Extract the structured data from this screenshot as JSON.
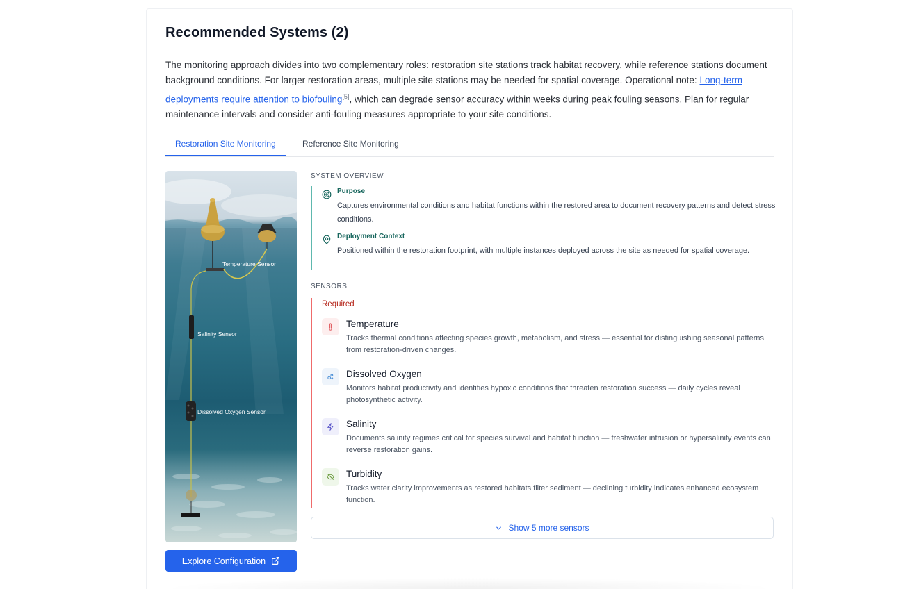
{
  "section": {
    "title": "Recommended Systems (2)",
    "intro_part1": "The monitoring approach divides into two complementary roles: restoration site stations track habitat recovery, while reference stations document background conditions. For larger restoration areas, multiple site stations may be needed for spatial coverage. Operational note: ",
    "intro_link": "Long-term deployments require attention to biofouling",
    "intro_citation": "[5]",
    "intro_part2": ", which can degrade sensor accuracy within weeks during peak fouling seasons. Plan for regular maintenance intervals and consider anti-fouling measures appropriate to your site conditions."
  },
  "tabs": [
    {
      "label": "Restoration Site Monitoring",
      "active": true
    },
    {
      "label": "Reference Site Monitoring",
      "active": false
    }
  ],
  "illustration": {
    "labels": [
      "Temperature Sensor",
      "Salinity Sensor",
      "Dissolved Oxygen Sensor"
    ]
  },
  "explore_button": {
    "label": "Explore Configuration",
    "icon": "external-link-icon"
  },
  "overview": {
    "heading": "SYSTEM OVERVIEW",
    "purpose_title": "Purpose",
    "purpose_text": "Captures environmental conditions and habitat functions within the restored area to document recovery patterns and detect stress conditions.",
    "context_title": "Deployment Context",
    "context_text": "Positioned within the restoration footprint, with multiple instances deployed across the site as needed for spatial coverage."
  },
  "sensors": {
    "heading": "SENSORS",
    "required_label": "Required",
    "items": [
      {
        "name": "Temperature",
        "icon": "thermometer-icon",
        "description": "Tracks thermal conditions affecting species growth, metabolism, and stress — essential for distinguishing seasonal patterns from restoration-driven changes."
      },
      {
        "name": "Dissolved Oxygen",
        "icon": "bubbles-icon",
        "description": "Monitors habitat productivity and identifies hypoxic conditions that threaten restoration success — daily cycles reveal photosynthetic activity."
      },
      {
        "name": "Salinity",
        "icon": "bolt-icon",
        "description": "Documents salinity regimes critical for species survival and habitat function — freshwater intrusion or hypersalinity events can reverse restoration gains."
      },
      {
        "name": "Turbidity",
        "icon": "eye-off-icon",
        "description": "Tracks water clarity improvements as restored habitats filter sediment — declining turbidity indicates enhanced ecosystem function."
      }
    ],
    "more_label": "Show 5 more sensors"
  },
  "colors": {
    "accent": "#2563eb",
    "overview_rule": "#5eb8ae",
    "required_rule": "#ef6b6b",
    "required_text": "#b42318"
  }
}
